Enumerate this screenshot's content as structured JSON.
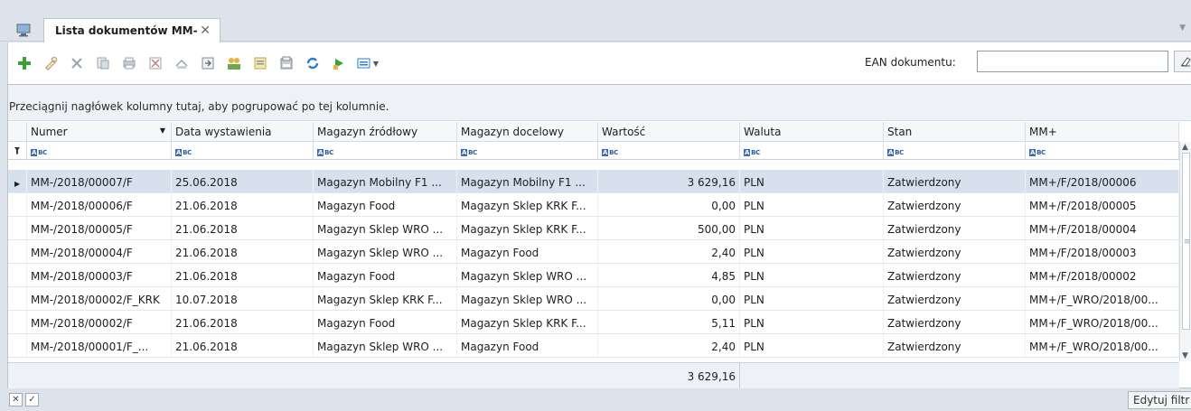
{
  "tab": {
    "label": "Lista dokumentów MM-",
    "close": "✕",
    "menu": "▼"
  },
  "toolbar": {
    "icons": [
      "add-icon",
      "edit-icon",
      "delete-icon",
      "copy-icon",
      "print-icon",
      "cancel-icon",
      "document-icon",
      "export-icon",
      "users-icon",
      "report-icon",
      "archive-icon",
      "refresh-icon",
      "run-icon",
      "view-icon"
    ],
    "ean_label": "EAN dokumentu:",
    "ean_value": "",
    "dropdown_arrow": "▼"
  },
  "grid": {
    "group_hint": "Przeciągnij nagłówek kolumny tutaj, aby pogrupować po tej kolumnie.",
    "filter_placeholder": "ABC",
    "columns": [
      "Numer",
      "Data wystawienia",
      "Magazyn źródłowy",
      "Magazyn docelowy",
      "Wartość",
      "Waluta",
      "Stan",
      "MM+"
    ],
    "rows": [
      [
        "MM-/2018/00007/F",
        "25.06.2018",
        "Magazyn Mobilny F1 ...",
        "Magazyn Mobilny F1 ...",
        "3 629,16",
        "PLN",
        "Zatwierdzony",
        "MM+/F/2018/00006"
      ],
      [
        "MM-/2018/00006/F",
        "21.06.2018",
        "Magazyn Food",
        "Magazyn Sklep KRK F...",
        "0,00",
        "PLN",
        "Zatwierdzony",
        "MM+/F/2018/00005"
      ],
      [
        "MM-/2018/00005/F",
        "21.06.2018",
        "Magazyn Sklep WRO ...",
        "Magazyn Sklep KRK F...",
        "500,00",
        "PLN",
        "Zatwierdzony",
        "MM+/F/2018/00004"
      ],
      [
        "MM-/2018/00004/F",
        "21.06.2018",
        "Magazyn Sklep WRO ...",
        "Magazyn Food",
        "2,40",
        "PLN",
        "Zatwierdzony",
        "MM+/F/2018/00003"
      ],
      [
        "MM-/2018/00003/F",
        "21.06.2018",
        "Magazyn Food",
        "Magazyn Sklep WRO ...",
        "4,85",
        "PLN",
        "Zatwierdzony",
        "MM+/F/2018/00002"
      ],
      [
        "MM-/2018/00002/F_KRK",
        "10.07.2018",
        "Magazyn Sklep KRK F...",
        "Magazyn Sklep WRO ...",
        "0,00",
        "PLN",
        "Zatwierdzony",
        "MM+/F_WRO/2018/00..."
      ],
      [
        "MM-/2018/00002/F",
        "21.06.2018",
        "Magazyn Food",
        "Magazyn Sklep KRK F...",
        "5,11",
        "PLN",
        "Zatwierdzony",
        "MM+/F_WRO/2018/00..."
      ],
      [
        "MM-/2018/00001/F_...",
        "21.06.2018",
        "Magazyn Sklep WRO ...",
        "Magazyn Food",
        "2,40",
        "PLN",
        "Zatwierdzony",
        "MM+/F_WRO/2018/00..."
      ]
    ],
    "total_value": "3 629,16"
  },
  "statusbar": {
    "edit_filter_label": "Edytuj filtr"
  }
}
